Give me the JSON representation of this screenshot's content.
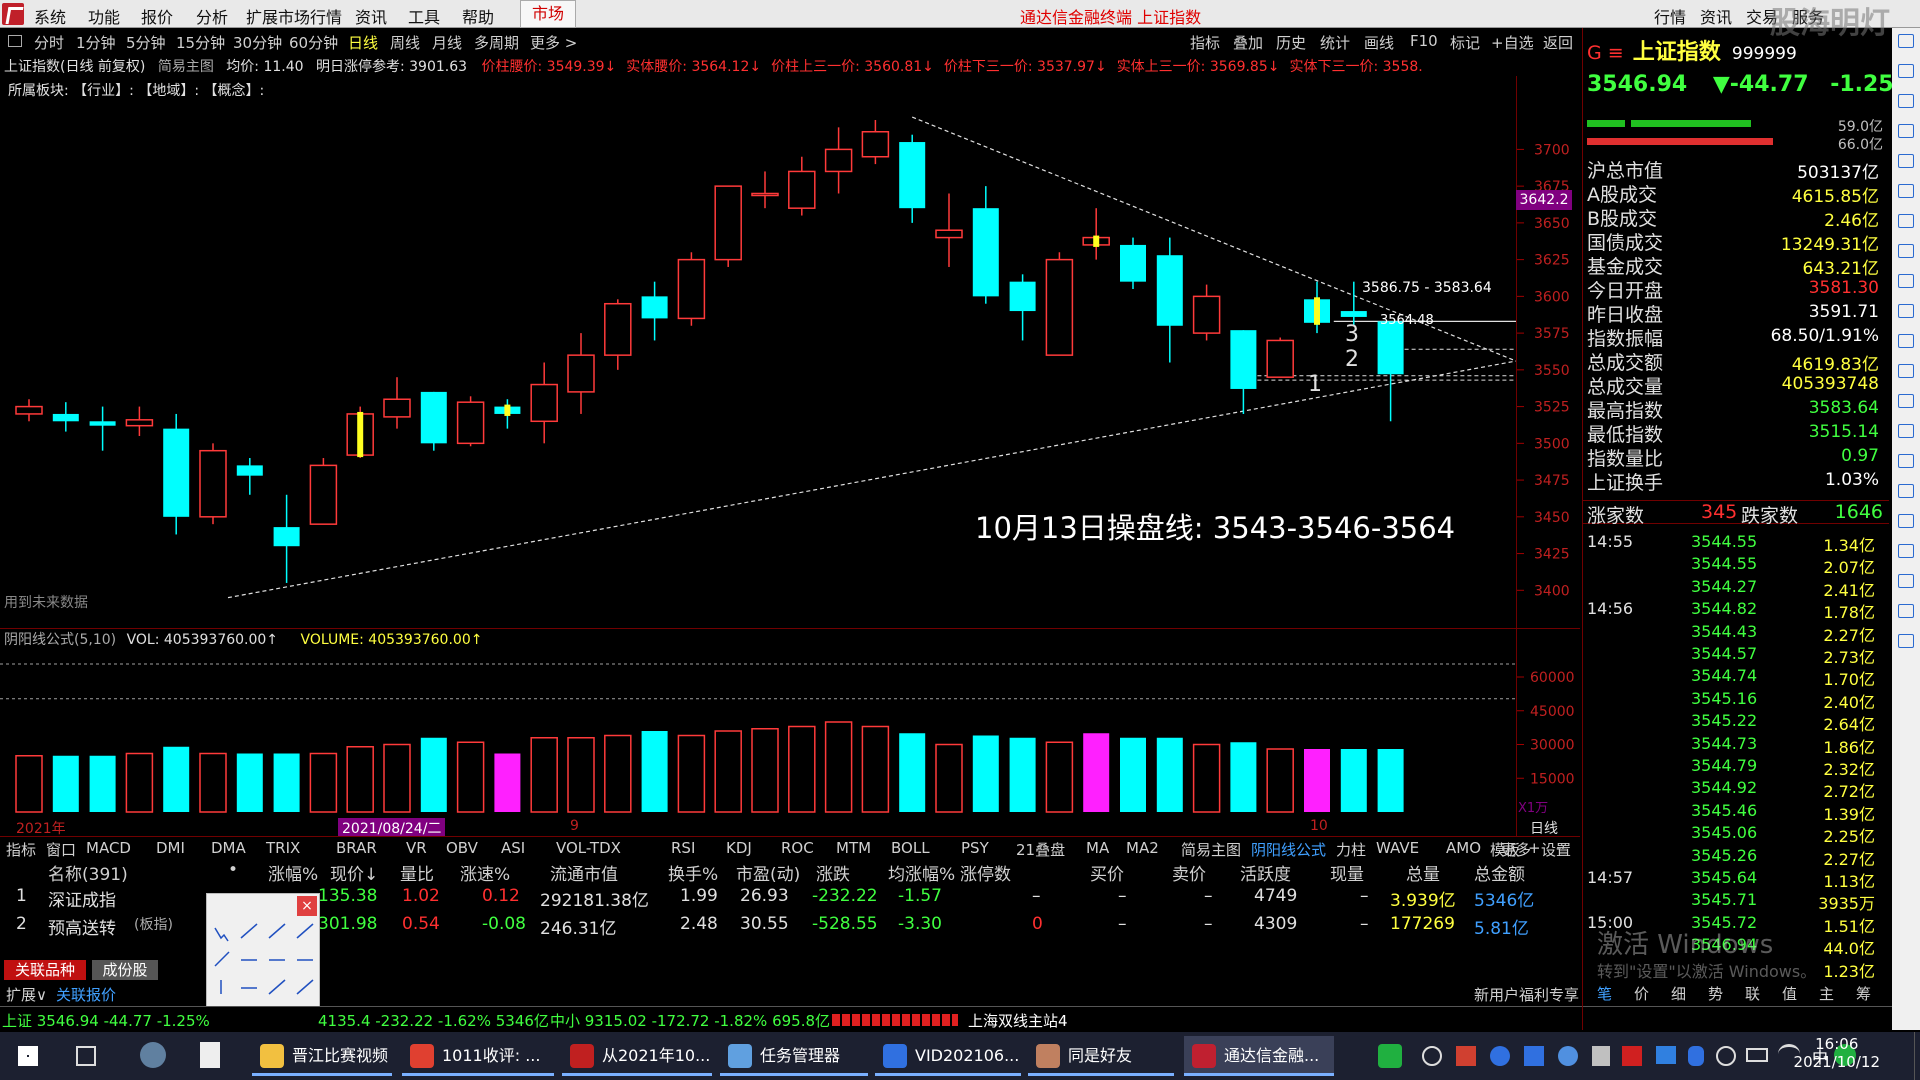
{
  "menubar": {
    "items": [
      "系统",
      "功能",
      "报价",
      "分析",
      "扩展市场行情",
      "资讯",
      "工具",
      "帮助"
    ],
    "market_label": "市场",
    "title": "通达信金融终端 上证指数",
    "right_tabs": [
      "行情",
      "资讯",
      "交易",
      "服务"
    ],
    "watermark": "股海明灯"
  },
  "periods": [
    "分时",
    "1分钟",
    "5分钟",
    "15分钟",
    "30分钟",
    "60分钟",
    "日线",
    "周线",
    "月线",
    "多周期",
    "更多 >"
  ],
  "active_period": "日线",
  "chart_tools": [
    "指标",
    "叠加",
    "历史",
    "统计",
    "画线",
    "F10",
    "标记",
    "+自选",
    "返回"
  ],
  "chart_info": {
    "title": "上证指数(日线 前复权)",
    "main_chart_label": "简易主图",
    "avg_price": "均价: 11.40",
    "tomorrow_limit": "明日涨停参考: 3901.63",
    "price_stats": [
      {
        "text": "价柱腰价: 3549.39↓",
        "color": "#ff3030"
      },
      {
        "text": "实体腰价: 3564.12↓",
        "color": "#ff3030"
      },
      {
        "text": "价柱上三一价: 3560.81↓",
        "color": "#ff3030"
      },
      {
        "text": "价柱下三一价: 3537.97↓",
        "color": "#ff3030"
      },
      {
        "text": "实体上三一价: 3569.85↓",
        "color": "#ff3030"
      },
      {
        "text": "实体下三一价: 3558.",
        "color": "#ff3030"
      }
    ]
  },
  "sector_row": "所属板块:   【行业】:      【地域】:      【概念】:",
  "price_axis": [
    "3700",
    "3675",
    "3650",
    "3625",
    "3600",
    "3575",
    "3550",
    "3525",
    "3500",
    "3475",
    "3450",
    "3425",
    "3400"
  ],
  "current_price_tag": "3642.2",
  "annotation": "10月13日操盘线:  3543-3546-3564",
  "range_label": "3586.75 - 3583.64",
  "point_label": "3564.48",
  "line_labels": [
    "3",
    "2",
    "1"
  ],
  "future_data_note": "用到未来数据",
  "volume_header": {
    "name": "阴阳线公式(5,10)",
    "vol": "VOL: 405393760.00↑",
    "volume": "VOLUME: 405393760.00↑"
  },
  "volume_axis": [
    "60000",
    "45000",
    "30000",
    "15000"
  ],
  "volume_axis_unit": "X1万",
  "date_labels": [
    "2021年",
    "2021/08/24/二",
    "9",
    "10"
  ],
  "period_footer": "日线",
  "chart_data": {
    "type": "candlestick",
    "series": [
      {
        "o": 3520,
        "h": 3530,
        "l": 3515,
        "c": 3525,
        "vol": 25000
      },
      {
        "o": 3520,
        "h": 3528,
        "l": 3508,
        "c": 3515,
        "vol": 25000
      },
      {
        "o": 3515,
        "h": 3525,
        "l": 3495,
        "c": 3512,
        "vol": 25000
      },
      {
        "o": 3512,
        "h": 3525,
        "l": 3505,
        "c": 3516,
        "vol": 26000
      },
      {
        "o": 3510,
        "h": 3520,
        "l": 3438,
        "c": 3450,
        "vol": 29000
      },
      {
        "o": 3450,
        "h": 3500,
        "l": 3445,
        "c": 3495,
        "vol": 26000
      },
      {
        "o": 3485,
        "h": 3490,
        "l": 3465,
        "c": 3478,
        "vol": 26000
      },
      {
        "o": 3443,
        "h": 3465,
        "l": 3405,
        "c": 3430,
        "vol": 26000
      },
      {
        "o": 3445,
        "h": 3490,
        "l": 3445,
        "c": 3485,
        "vol": 26000
      },
      {
        "o": 3492,
        "h": 3525,
        "l": 3490,
        "c": 3520,
        "vol": 29000
      },
      {
        "o": 3518,
        "h": 3545,
        "l": 3510,
        "c": 3530,
        "vol": 30000
      },
      {
        "o": 3535,
        "h": 3535,
        "l": 3495,
        "c": 3500,
        "vol": 33000
      },
      {
        "o": 3500,
        "h": 3532,
        "l": 3498,
        "c": 3528,
        "vol": 31000
      },
      {
        "o": 3525,
        "h": 3530,
        "l": 3510,
        "c": 3520,
        "vol": 26000
      },
      {
        "o": 3515,
        "h": 3555,
        "l": 3500,
        "c": 3540,
        "vol": 33000
      },
      {
        "o": 3535,
        "h": 3575,
        "l": 3520,
        "c": 3560,
        "vol": 33000
      },
      {
        "o": 3560,
        "h": 3598,
        "l": 3550,
        "c": 3595,
        "vol": 34000
      },
      {
        "o": 3600,
        "h": 3610,
        "l": 3570,
        "c": 3585,
        "vol": 36000
      },
      {
        "o": 3585,
        "h": 3630,
        "l": 3580,
        "c": 3625,
        "vol": 34000
      },
      {
        "o": 3625,
        "h": 3675,
        "l": 3620,
        "c": 3675,
        "vol": 36000
      },
      {
        "o": 3670,
        "h": 3685,
        "l": 3660,
        "c": 3670,
        "vol": 37000
      },
      {
        "o": 3660,
        "h": 3695,
        "l": 3655,
        "c": 3685,
        "vol": 38000
      },
      {
        "o": 3685,
        "h": 3715,
        "l": 3670,
        "c": 3700,
        "vol": 40000
      },
      {
        "o": 3695,
        "h": 3720,
        "l": 3690,
        "c": 3712,
        "vol": 38000
      },
      {
        "o": 3705,
        "h": 3710,
        "l": 3650,
        "c": 3660,
        "vol": 35000
      },
      {
        "o": 3640,
        "h": 3670,
        "l": 3620,
        "c": 3645,
        "vol": 30000
      },
      {
        "o": 3660,
        "h": 3675,
        "l": 3595,
        "c": 3600,
        "vol": 34000
      },
      {
        "o": 3610,
        "h": 3615,
        "l": 3570,
        "c": 3590,
        "vol": 33000
      },
      {
        "o": 3560,
        "h": 3630,
        "l": 3560,
        "c": 3625,
        "vol": 31000
      },
      {
        "o": 3635,
        "h": 3660,
        "l": 3625,
        "c": 3640,
        "vol": 35000
      },
      {
        "o": 3635,
        "h": 3640,
        "l": 3605,
        "c": 3610,
        "vol": 33000
      },
      {
        "o": 3628,
        "h": 3640,
        "l": 3555,
        "c": 3580,
        "vol": 33000
      },
      {
        "o": 3575,
        "h": 3608,
        "l": 3570,
        "c": 3600,
        "vol": 30000
      },
      {
        "o": 3577,
        "h": 3577,
        "l": 3520,
        "c": 3537,
        "vol": 31000
      },
      {
        "o": 3545,
        "h": 3572,
        "l": 3545,
        "c": 3570,
        "vol": 28000
      },
      {
        "o": 3598,
        "h": 3610,
        "l": 3575,
        "c": 3582,
        "vol": 28000
      },
      {
        "o": 3590,
        "h": 3610,
        "l": 3580,
        "c": 3586,
        "vol": 28000
      },
      {
        "o": 3583,
        "h": 3583,
        "l": 3515,
        "c": 3547,
        "vol": 28000
      }
    ],
    "price_range": [
      3390,
      3720
    ],
    "volume_range": [
      0,
      72000
    ]
  },
  "right_panel": {
    "symbol_prefix": "G ≡",
    "name": "上证指数",
    "code": "999999",
    "price": "3546.94",
    "change": "▼-44.77",
    "change_pct": "-1.25%",
    "bar1_pct": "59.0亿",
    "bar2_pct": "66.0亿",
    "stats": [
      {
        "label": "沪总市值",
        "value": "503137亿",
        "color": "#ffffff"
      },
      {
        "label": "A股成交",
        "value": "4615.85亿",
        "color": "#ffff40"
      },
      {
        "label": "B股成交",
        "value": "2.46亿",
        "color": "#ffff40"
      },
      {
        "label": "国债成交",
        "value": "13249.31亿",
        "color": "#ffff40"
      },
      {
        "label": "基金成交",
        "value": "643.21亿",
        "color": "#ffff40"
      },
      {
        "label": "今日开盘",
        "value": "3581.30",
        "color": "#ff3030"
      },
      {
        "label": "昨日收盘",
        "value": "3591.71",
        "color": "#ffffff"
      },
      {
        "label": "指数振幅",
        "value": "68.50/1.91%",
        "color": "#ffffff"
      },
      {
        "label": "总成交额",
        "value": "4619.83亿",
        "color": "#ffff40"
      },
      {
        "label": "总成交量",
        "value": "405393748",
        "color": "#ffff40"
      },
      {
        "label": "最高指数",
        "value": "3583.64",
        "color": "#40ff40"
      },
      {
        "label": "最低指数",
        "value": "3515.14",
        "color": "#40ff40"
      },
      {
        "label": "指数量比",
        "value": "0.97",
        "color": "#40ff40"
      },
      {
        "label": "上证换手",
        "value": "1.03%",
        "color": "#ffffff"
      }
    ],
    "up_label": "涨家数",
    "up_count": "345",
    "down_label": "跌家数",
    "down_count": "1646",
    "ticks": [
      {
        "time": "14:55",
        "price": "3544.55",
        "amt": "1.34亿"
      },
      {
        "time": "",
        "price": "3544.55",
        "amt": "2.07亿"
      },
      {
        "time": "",
        "price": "3544.27",
        "amt": "2.41亿"
      },
      {
        "time": "14:56",
        "price": "3544.82",
        "amt": "1.78亿"
      },
      {
        "time": "",
        "price": "3544.43",
        "amt": "2.27亿"
      },
      {
        "time": "",
        "price": "3544.57",
        "amt": "2.73亿"
      },
      {
        "time": "",
        "price": "3544.74",
        "amt": "1.70亿"
      },
      {
        "time": "",
        "price": "3545.16",
        "amt": "2.40亿"
      },
      {
        "time": "",
        "price": "3545.22",
        "amt": "2.64亿"
      },
      {
        "time": "",
        "price": "3544.73",
        "amt": "1.86亿"
      },
      {
        "time": "",
        "price": "3544.79",
        "amt": "2.32亿"
      },
      {
        "time": "",
        "price": "3544.92",
        "amt": "2.72亿"
      },
      {
        "time": "",
        "price": "3545.46",
        "amt": "1.39亿"
      },
      {
        "time": "",
        "price": "3545.06",
        "amt": "2.25亿"
      },
      {
        "time": "",
        "price": "3545.26",
        "amt": "2.27亿"
      },
      {
        "time": "14:57",
        "price": "3545.64",
        "amt": "1.13亿"
      },
      {
        "time": "",
        "price": "3545.71",
        "amt": "3935万"
      },
      {
        "time": "15:00",
        "price": "3545.72",
        "amt": "1.51亿"
      },
      {
        "time": "",
        "price": "3546.94",
        "amt": "44.0亿"
      },
      {
        "time": "",
        "price": "",
        "amt": "1.23亿"
      }
    ],
    "activation_title": "激活 Windows",
    "activation_sub": "转到\"设置\"以激活 Windows。",
    "bottom_tabs": [
      "笔",
      "价",
      "细",
      "势",
      "联",
      "值",
      "主",
      "筹"
    ]
  },
  "indicator_tabs": [
    "指标",
    "窗口",
    "MACD",
    "DMI",
    "DMA",
    "TRIX",
    "BRAR",
    "VR",
    "OBV",
    "ASI",
    "VOL-TDX",
    "RSI",
    "KDJ",
    "ROC",
    "MTM",
    "BOLL",
    "PSY",
    "21叠盘",
    "MA",
    "MA2",
    "简易主图",
    "阴阳线公式",
    "力柱",
    "WAVE",
    "AMO",
    "更多",
    "设置"
  ],
  "active_indicator": "阴阳线公式",
  "indicator_right": [
    "模板",
    "+",
    "-"
  ],
  "table": {
    "headers": [
      "名称(391)",
      "•",
      "涨幅%",
      "现价↓",
      "量比",
      "涨速%",
      "流通市值",
      "换手%",
      "市盈(动)",
      "涨跌",
      "均涨幅%",
      "涨停数",
      "买价",
      "卖价",
      "活跃度",
      "现量",
      "总量",
      "总金额"
    ],
    "rows": [
      [
        "1",
        "深证成指",
        "",
        "135.38",
        "1.02",
        "0.12",
        "292181.38亿",
        "1.99",
        "26.93",
        "-232.22",
        "-1.57",
        "–",
        "–",
        "–",
        "4749",
        "–",
        "3.939亿",
        "5346亿"
      ],
      [
        "2",
        "预高送转",
        "(板指)",
        "301.98",
        "0.54",
        "-0.08",
        "246.31亿",
        "2.48",
        "30.55",
        "-528.55",
        "-3.30",
        "0",
        "–",
        "–",
        "4309",
        "–",
        "177269",
        "5.81亿"
      ]
    ]
  },
  "bottom_tabs": [
    "关联品种",
    "成份股"
  ],
  "bottom_row": [
    "扩展∨",
    "关联报价"
  ],
  "bottom_right_note": "新用户福利专享",
  "status_bar": {
    "items": [
      {
        "text": "上证 3546.94 -44.77 -1.25%",
        "color": "#40ff40"
      },
      {
        "text": "4135.4 -232.22 -1.62% 5346亿",
        "color": "#40ff40"
      },
      {
        "text": "中小 9315.02 -172.72 -1.82% 695.8亿",
        "color": "#40ff40"
      },
      {
        "text": "上海双线主站4",
        "color": "#ffffff"
      }
    ]
  },
  "taskbar": {
    "apps": [
      {
        "label": "晋江比赛视频",
        "color": "#f2c040"
      },
      {
        "label": "1011收评: ...",
        "color": "#e04030"
      },
      {
        "label": "从2021年10...",
        "color": "#c02020"
      },
      {
        "label": "任务管理器",
        "color": "#60a0e0"
      },
      {
        "label": "VID202106...",
        "color": "#3070e0"
      },
      {
        "label": "同是好友",
        "color": "#c08060"
      },
      {
        "label": "通达信金融...",
        "color": "#c02030"
      }
    ],
    "time": "16:06",
    "date": "2021/10/12",
    "ime": "中"
  }
}
